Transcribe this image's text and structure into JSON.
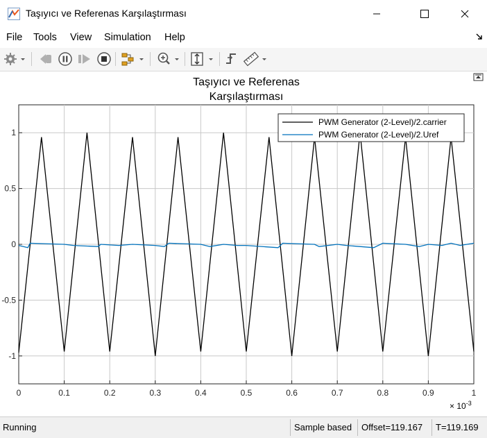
{
  "window": {
    "title": "Taşıyıcı ve Referenas Karşılaştırması"
  },
  "menu": {
    "items": [
      "File",
      "Tools",
      "View",
      "Simulation",
      "Help"
    ]
  },
  "plot": {
    "title_line1": "Taşıyıcı ve Referenas",
    "title_line2": "Karşılaştırması",
    "x_exponent_base": "× 10",
    "x_exponent_power": "-3"
  },
  "status": {
    "state": "Running",
    "mode": "Sample based",
    "offset": "Offset=119.167",
    "time": "T=119.169"
  },
  "chart_data": {
    "type": "line",
    "title": "Taşıyıcı ve Referenas Karşılaştırması",
    "x_scale_note": "× 10^-3",
    "xlim": [
      0,
      1
    ],
    "ylim": [
      -1.25,
      1.25
    ],
    "x_ticks": [
      "0",
      "0.1",
      "0.2",
      "0.3",
      "0.4",
      "0.5",
      "0.6",
      "0.7",
      "0.8",
      "0.9",
      "1"
    ],
    "y_ticks": [
      "1",
      "0.5",
      "0",
      "-0.5",
      "-1"
    ],
    "grid": true,
    "legend_position": "top-right",
    "series": [
      {
        "name": "PWM Generator (2-Level)/2.carrier",
        "color": "#000000",
        "x": [
          0,
          0.05,
          0.1,
          0.15,
          0.2,
          0.25,
          0.3,
          0.35,
          0.4,
          0.45,
          0.5,
          0.55,
          0.6,
          0.65,
          0.7,
          0.75,
          0.8,
          0.85,
          0.9,
          0.95,
          1.0
        ],
        "y": [
          -0.97,
          0.96,
          -0.96,
          1.0,
          -0.96,
          0.96,
          -1.0,
          0.96,
          -0.96,
          1.0,
          -0.96,
          0.96,
          -1.0,
          0.96,
          -0.96,
          1.0,
          -0.96,
          0.96,
          -1.0,
          0.96,
          -0.96
        ]
      },
      {
        "name": "PWM Generator (2-Level)/2.Uref",
        "color": "#0072bd",
        "x": [
          0,
          0.02,
          0.025,
          0.1,
          0.12,
          0.175,
          0.18,
          0.22,
          0.25,
          0.3,
          0.32,
          0.33,
          0.4,
          0.42,
          0.45,
          0.48,
          0.5,
          0.57,
          0.58,
          0.65,
          0.66,
          0.7,
          0.72,
          0.78,
          0.8,
          0.85,
          0.88,
          0.9,
          0.93,
          0.95,
          0.97,
          1.0
        ],
        "y": [
          -0.01,
          -0.03,
          0.01,
          0.0,
          -0.01,
          -0.02,
          0.0,
          -0.01,
          0.0,
          -0.01,
          -0.02,
          0.01,
          0.0,
          -0.02,
          0.0,
          -0.01,
          -0.01,
          -0.03,
          0.01,
          0.0,
          -0.02,
          0.0,
          -0.01,
          -0.03,
          0.01,
          0.0,
          -0.02,
          0.0,
          -0.01,
          0.01,
          -0.01,
          0.01
        ]
      }
    ]
  }
}
